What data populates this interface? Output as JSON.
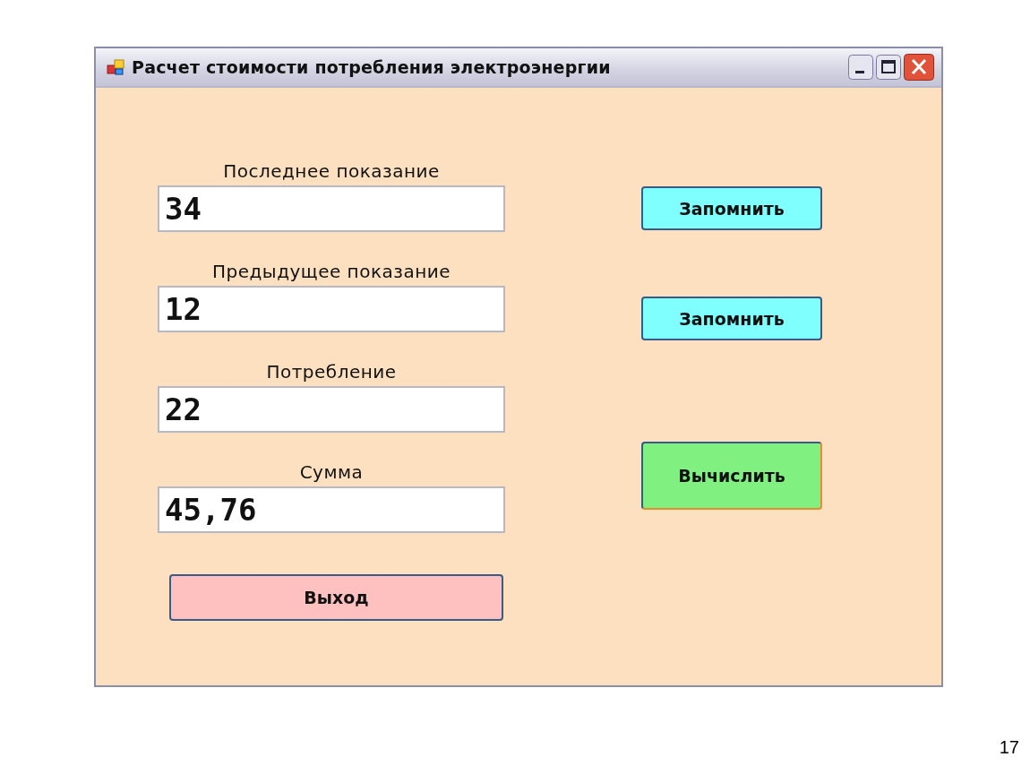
{
  "window": {
    "title": "Расчет стоимости потребления электроэнергии"
  },
  "fields": [
    {
      "label": "Последнее показание",
      "value": "34"
    },
    {
      "label": "Предыдущее показание",
      "value": "12"
    },
    {
      "label": "Потребление",
      "value": "22"
    },
    {
      "label": "Сумма",
      "value": "45,76"
    }
  ],
  "exit_button": {
    "label": "Выход",
    "kind": "exit"
  },
  "buttons": [
    {
      "label": "Запомнить",
      "kind": "remember"
    },
    {
      "label": "Запомнить",
      "kind": "remember"
    },
    {
      "label": "Вычислить",
      "kind": "calculate"
    }
  ],
  "slide_number": "17"
}
